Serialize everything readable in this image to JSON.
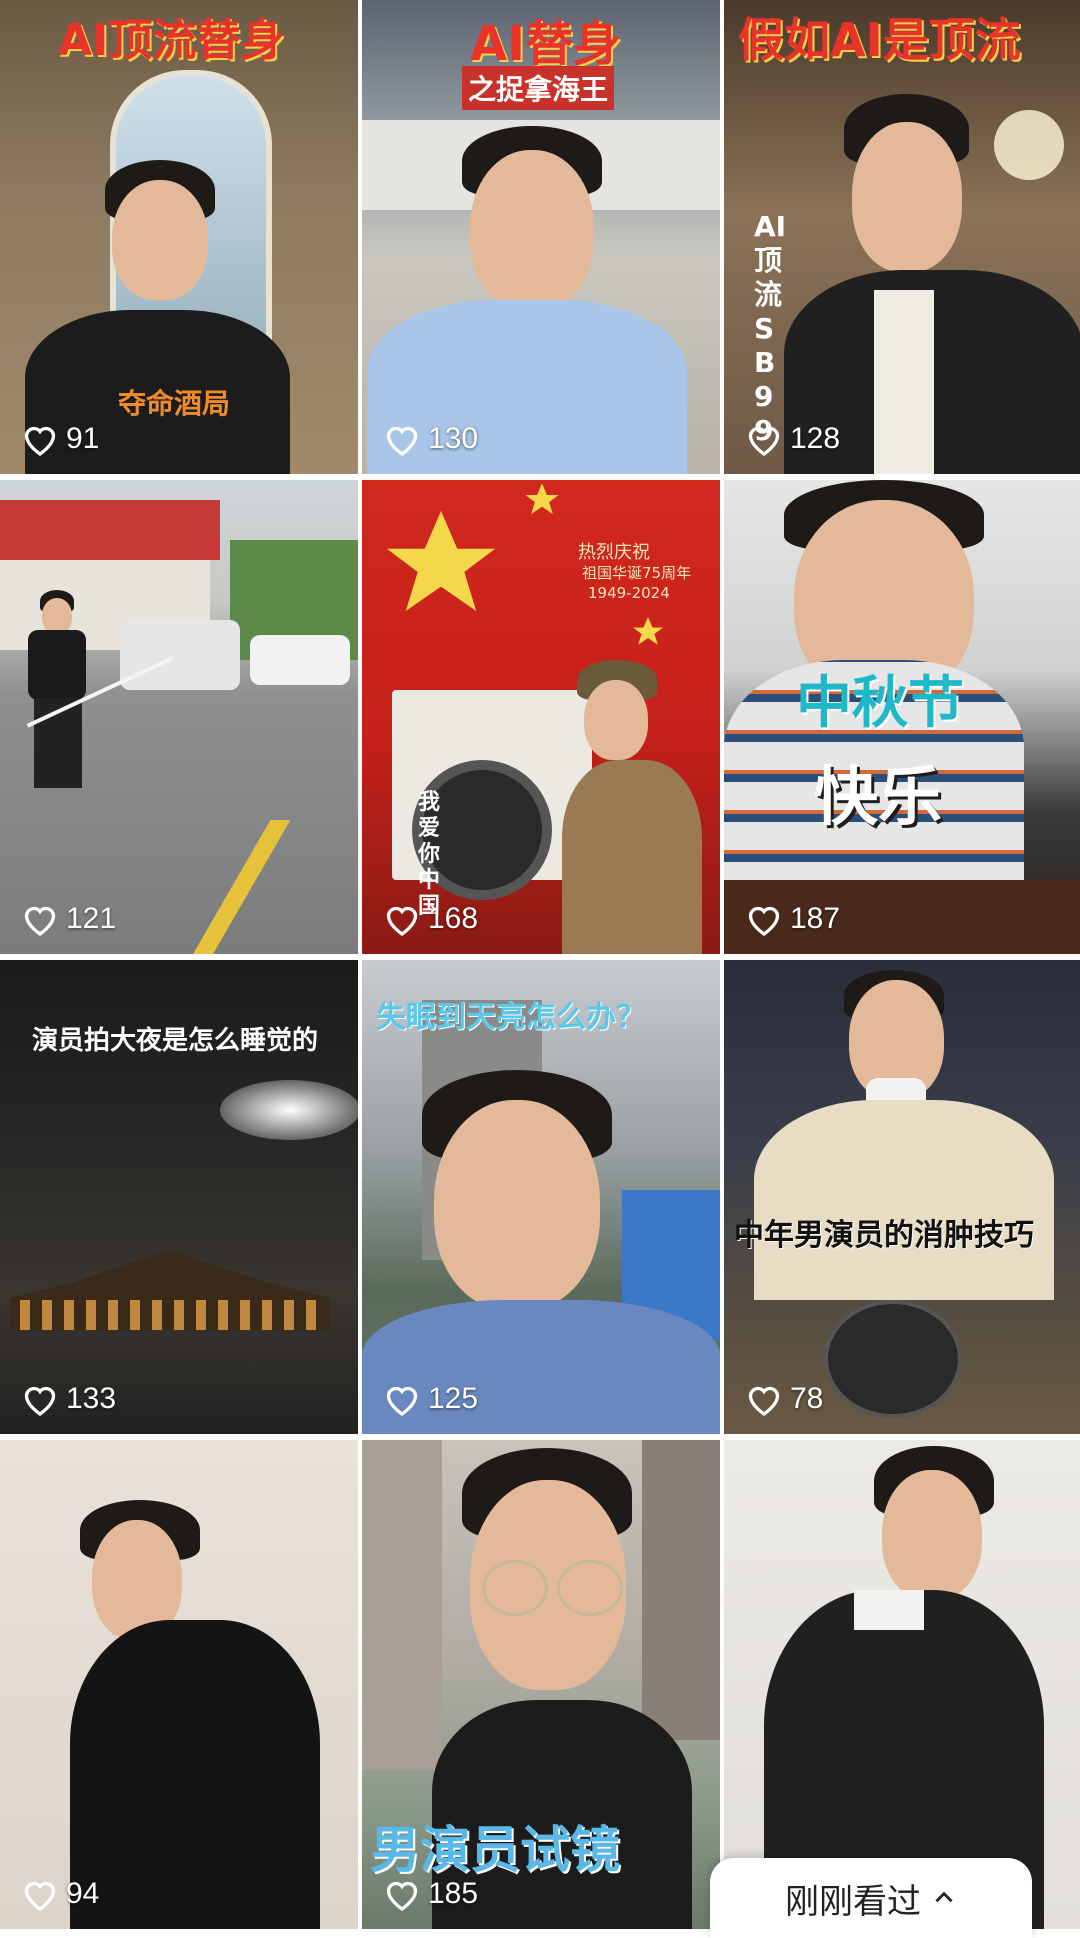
{
  "tiles": [
    {
      "likes": "91",
      "title": "AI顶流替身",
      "caption": "夺命酒局"
    },
    {
      "likes": "130",
      "title": "AI替身",
      "subtitle": "之捉拿海王"
    },
    {
      "likes": "128",
      "title": "假如AI是顶流",
      "side_text": "AI顶流SB99"
    },
    {
      "likes": "121"
    },
    {
      "likes": "168",
      "banner_line1": "热烈庆祝",
      "banner_line2": "祖国华诞75周年",
      "banner_line3": "1949-2024",
      "side_text": "我爱你中国"
    },
    {
      "likes": "187",
      "title": "中秋节",
      "subtitle": "快乐"
    },
    {
      "likes": "133",
      "title": "演员拍大夜是怎么睡觉的"
    },
    {
      "likes": "125",
      "title": "失眠到天亮怎么办？"
    },
    {
      "likes": "78",
      "title": "中年男演员的消肿技巧"
    },
    {
      "likes": "94"
    },
    {
      "likes": "185",
      "title": "男演员试镜"
    },
    {
      "likes": ""
    }
  ],
  "recently_viewed": {
    "label": "刚刚看过",
    "icon": "chevron-up-icon"
  }
}
